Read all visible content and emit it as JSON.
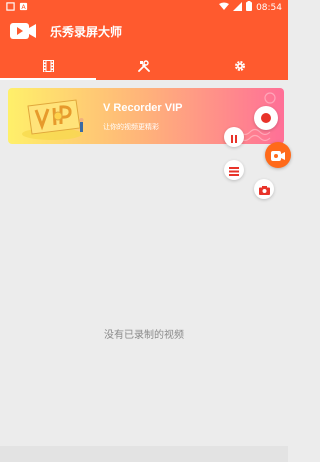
{
  "status_bar": {
    "time": "08:54",
    "left_icons": [
      "notification-box-icon",
      "notification-a-icon"
    ],
    "right_icons": [
      "wifi-icon",
      "cellular-icon",
      "battery-icon"
    ]
  },
  "app_bar": {
    "title": "乐秀录屏大师",
    "background": "#ff5a2e"
  },
  "tabs": [
    {
      "icon": "film-icon",
      "active": true
    },
    {
      "icon": "tools-icon",
      "active": false
    },
    {
      "icon": "settings-icon",
      "active": false
    }
  ],
  "banner": {
    "title": "V Recorder VIP",
    "subtitle": "让你的视频更精彩"
  },
  "floating_controls": [
    {
      "icon": "record-icon"
    },
    {
      "icon": "pause-icon"
    },
    {
      "icon": "recorder-main-icon"
    },
    {
      "icon": "list-icon"
    },
    {
      "icon": "camera-icon"
    }
  ],
  "empty_state": {
    "text": "没有已录制的视频"
  }
}
